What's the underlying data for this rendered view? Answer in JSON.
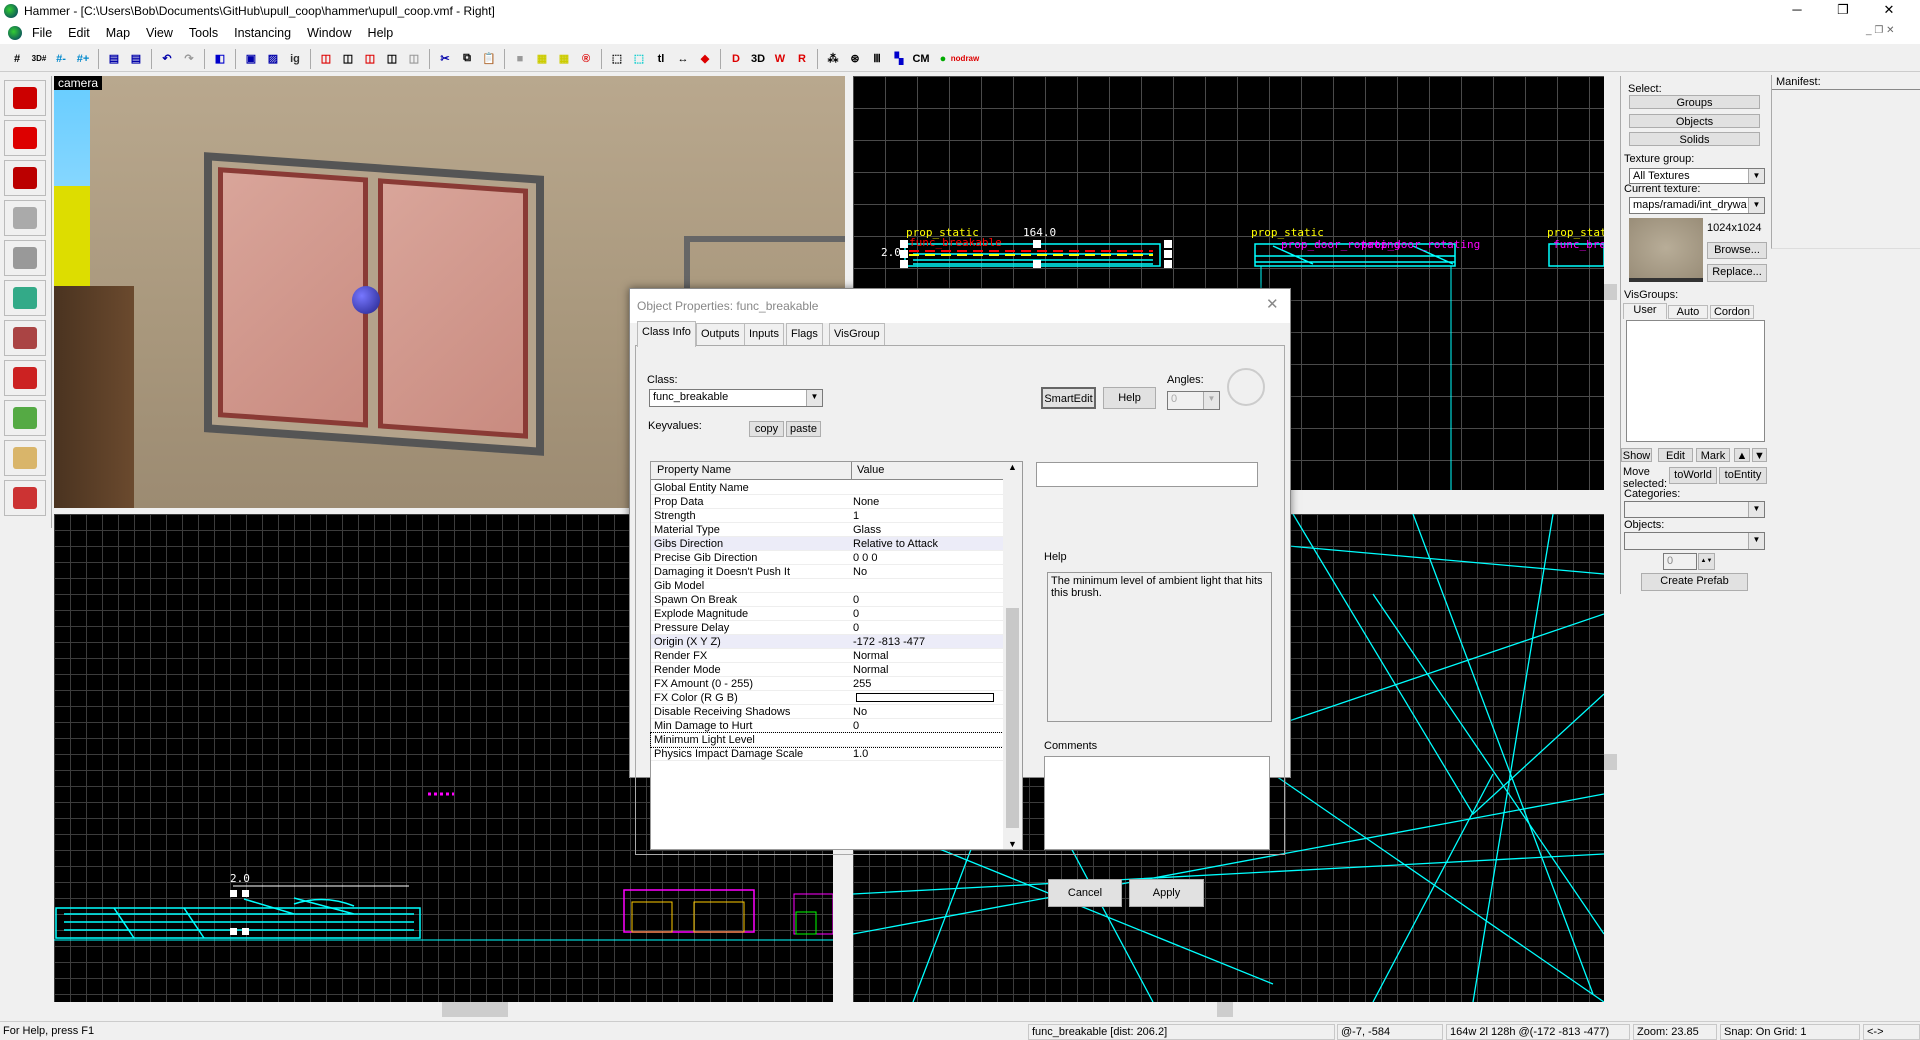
{
  "window": {
    "title": "Hammer - [C:\\Users\\Bob\\Documents\\GitHub\\upull_coop\\hammer\\upull_coop.vmf - Right]",
    "minimize": "─",
    "restore": "❐",
    "close": "✕"
  },
  "menu": [
    "File",
    "Edit",
    "Map",
    "View",
    "Tools",
    "Instancing",
    "Window",
    "Help"
  ],
  "toolbar": [
    {
      "icon": "grid-toggle-icon",
      "g": "#",
      "c": "#000"
    },
    {
      "icon": "3d-grid-icon",
      "g": "3D#",
      "c": "#000"
    },
    {
      "icon": "smaller-grid-icon",
      "g": "#-",
      "c": "#08c"
    },
    {
      "icon": "larger-grid-icon",
      "g": "#+",
      "c": "#08c"
    },
    null,
    {
      "icon": "load-window-state-icon",
      "g": "▤",
      "c": "#00a"
    },
    {
      "icon": "save-window-state-icon",
      "g": "▤",
      "c": "#00a"
    },
    null,
    {
      "icon": "undo-icon",
      "g": "↶",
      "c": "#00a"
    },
    {
      "icon": "redo-icon",
      "g": "↷",
      "c": "#999"
    },
    null,
    {
      "icon": "carve-icon",
      "g": "◧",
      "c": "#00c"
    },
    null,
    {
      "icon": "group-icon",
      "g": "▣",
      "c": "#00a"
    },
    {
      "icon": "ungroup-icon",
      "g": "▨",
      "c": "#00a"
    },
    {
      "icon": "ignore-groups-icon",
      "g": "ig",
      "c": "#333"
    },
    null,
    {
      "icon": "hide-selected-icon",
      "g": "◫",
      "c": "#d00"
    },
    {
      "icon": "hide-unselected-icon",
      "g": "◫",
      "c": "#000"
    },
    {
      "icon": "show-hidden-icon",
      "g": "◫",
      "c": "#d00"
    },
    {
      "icon": "quick-hide-icon",
      "g": "◫",
      "c": "#000"
    },
    {
      "icon": "unhide-icon",
      "g": "◫",
      "c": "#999"
    },
    null,
    {
      "icon": "cut-icon",
      "g": "✂",
      "c": "#00a"
    },
    {
      "icon": "copy-icon",
      "g": "⧉",
      "c": "#000"
    },
    {
      "icon": "paste-icon",
      "g": "📋",
      "c": "#999"
    },
    null,
    {
      "icon": "texture-lock-icon",
      "g": "■",
      "c": "#999"
    },
    {
      "icon": "toggle-texture-icon",
      "g": "▦",
      "c": "#cc0"
    },
    {
      "icon": "texture-scale-lock-icon",
      "g": "▦",
      "c": "#cc0"
    },
    {
      "icon": "radius-culling-icon",
      "g": "®",
      "c": "#d00"
    },
    null,
    {
      "icon": "toggle-select-by-handles-icon",
      "g": "⬚",
      "c": "#000"
    },
    {
      "icon": "select-by-center-icon",
      "g": "⬚",
      "c": "#0cc"
    },
    {
      "icon": "toggle-labels-icon",
      "g": "tl",
      "c": "#000"
    },
    {
      "icon": "auto-select-icon",
      "g": "↔",
      "c": "#000"
    },
    {
      "icon": "toggle-helpers-icon",
      "g": "◆",
      "c": "#d00"
    },
    null,
    {
      "icon": "toggle-2d-models-icon",
      "g": "D",
      "c": "#d00"
    },
    {
      "icon": "toggle-3d-models-icon",
      "g": "3D",
      "c": "#000"
    },
    {
      "icon": "toggle-wireframe-icon",
      "g": "W",
      "c": "#d00"
    },
    {
      "icon": "toggle-render-icon",
      "g": "R",
      "c": "#d00"
    },
    null,
    {
      "icon": "move-tool-icon",
      "g": "⁂",
      "c": "#000"
    },
    {
      "icon": "compile-icon",
      "g": "⊛",
      "c": "#000"
    },
    {
      "icon": "hide-items-icon",
      "g": "Ⅲ",
      "c": "#000"
    },
    {
      "icon": "cubemap-icon",
      "g": "▚",
      "c": "#00c"
    },
    {
      "icon": "cubemap-text-icon",
      "g": "CM",
      "c": "#000"
    },
    {
      "icon": "run-map-icon",
      "g": "●",
      "c": "#0a0"
    },
    {
      "icon": "nodraw-icon",
      "g": "nodraw",
      "c": "#d00"
    }
  ],
  "tools": [
    {
      "icon": "selection-tool-icon",
      "c": "#c00"
    },
    {
      "icon": "magnify-tool-icon",
      "c": "#d00"
    },
    {
      "icon": "camera-tool-icon",
      "c": "#b00"
    },
    {
      "icon": "entity-tool-icon",
      "c": "#aaa"
    },
    {
      "icon": "block-tool-icon",
      "c": "#999"
    },
    {
      "icon": "texture-application-icon",
      "c": "#3a8"
    },
    {
      "icon": "apply-texture-icon",
      "c": "#a44"
    },
    {
      "icon": "decal-tool-icon",
      "c": "#c22"
    },
    {
      "icon": "overlay-tool-icon",
      "c": "#5a4"
    },
    {
      "icon": "clipping-tool-icon",
      "c": "#d9b56a"
    },
    {
      "icon": "vertex-tool-icon",
      "c": "#c33"
    }
  ],
  "viewports": {
    "camera": {
      "label": "camera"
    },
    "top_right": {
      "labels": [
        "prop_static",
        "164.0",
        "2.0",
        "func_breakable",
        "prop_static",
        "prop_door_rotating",
        "prop_door_rotating",
        "prop_static",
        "func_breakable"
      ]
    },
    "bottom_left": {
      "labels": [
        "2.0"
      ]
    }
  },
  "dialog": {
    "title": "Object Properties: func_breakable",
    "tabs": [
      "Class Info",
      "Outputs",
      "Inputs",
      "Flags",
      "VisGroup"
    ],
    "class_label": "Class:",
    "class_value": "func_breakable",
    "keyvalues_label": "Keyvalues:",
    "copy": "copy",
    "paste": "paste",
    "smartedit": "SmartEdit",
    "help_button": "Help",
    "angles_label": "Angles:",
    "angles_value": "0",
    "col_name": "Property Name",
    "col_value": "Value",
    "rows": [
      {
        "n": "Global Entity Name",
        "v": ""
      },
      {
        "n": "Prop Data",
        "v": "None"
      },
      {
        "n": "Strength",
        "v": "1"
      },
      {
        "n": "Material Type",
        "v": "Glass"
      },
      {
        "n": "Gibs Direction",
        "v": "Relative to Attack",
        "hl": true
      },
      {
        "n": "Precise Gib Direction",
        "v": "0 0 0"
      },
      {
        "n": "Damaging it Doesn't Push It",
        "v": "No"
      },
      {
        "n": "Gib Model",
        "v": ""
      },
      {
        "n": "Spawn On Break",
        "v": "0"
      },
      {
        "n": "Explode Magnitude",
        "v": "0"
      },
      {
        "n": "Pressure Delay",
        "v": "0"
      },
      {
        "n": "Origin (X Y Z)",
        "v": "-172 -813 -477",
        "hl": true
      },
      {
        "n": "Render FX",
        "v": "Normal"
      },
      {
        "n": "Render Mode",
        "v": "Normal"
      },
      {
        "n": "FX Amount (0 - 255)",
        "v": "255"
      },
      {
        "n": "FX Color (R G B)",
        "v": "",
        "color": "#ffffff"
      },
      {
        "n": "Disable Receiving Shadows",
        "v": "No"
      },
      {
        "n": "Min Damage to Hurt",
        "v": "0"
      },
      {
        "n": "Minimum Light Level",
        "v": "",
        "sel": true
      },
      {
        "n": "Physics Impact Damage Scale",
        "v": "1.0"
      }
    ],
    "help_label": "Help",
    "help_text": "The minimum level of ambient light that hits this brush.",
    "comments_label": "Comments",
    "cancel": "Cancel",
    "apply": "Apply"
  },
  "panel": {
    "select_label": "Select:",
    "groups": "Groups",
    "objects": "Objects",
    "solids": "Solids",
    "texture_group_label": "Texture group:",
    "texture_group": "All Textures",
    "current_texture_label": "Current texture:",
    "current_texture": "maps/ramadi/int_drywa",
    "texture_size": "1024x1024",
    "browse": "Browse...",
    "replace": "Replace...",
    "visgroups_label": "VisGroups:",
    "vis_tabs": [
      "User",
      "Auto",
      "Cordon"
    ],
    "show": "Show",
    "edit": "Edit",
    "mark": "Mark",
    "move_selected": "Move selected:",
    "to_world": "toWorld",
    "to_entity": "toEntity",
    "categories_label": "Categories:",
    "objects_label": "Objects:",
    "spinner_value": "0",
    "create_prefab": "Create Prefab",
    "manifest_label": "Manifest:"
  },
  "status": {
    "help": "For Help, press F1",
    "selection": "func_breakable  [dist: 206.2]",
    "cursor": "@-7, -584",
    "size": "164w 2l 128h @(-172 -813 -477)",
    "zoom": "Zoom: 23.85",
    "snap": "Snap: On Grid: 1",
    "arrows": "<->"
  }
}
